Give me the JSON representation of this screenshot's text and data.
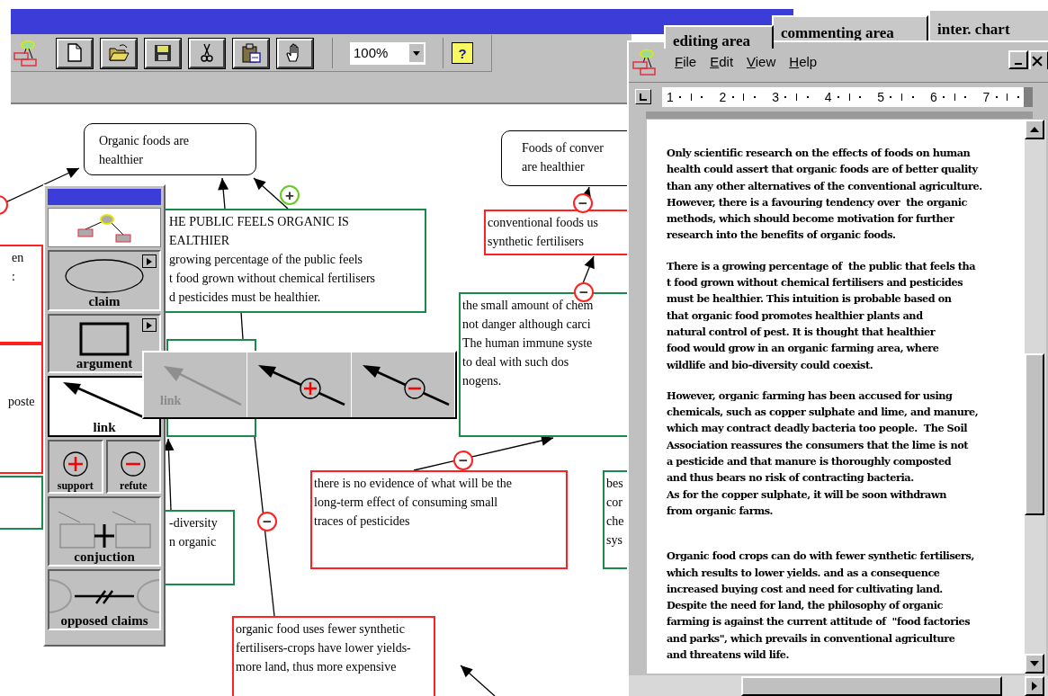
{
  "toolbar": {
    "buttons": [
      {
        "kind": "new"
      },
      {
        "kind": "open"
      },
      {
        "kind": "save"
      },
      {
        "kind": "cut"
      },
      {
        "kind": "paste"
      },
      {
        "kind": "hand"
      }
    ],
    "zoom": "100%",
    "help": "?"
  },
  "nodes": [
    {
      "kind": "claim",
      "color": "#000000",
      "text": "Organic foods are\nhealthier"
    },
    {
      "kind": "claim",
      "color": "#000000",
      "text": "Foods of conver\nare healthier"
    },
    {
      "kind": "argument",
      "color": "#1a8a4a",
      "text": "HE PUBLIC FEELS ORGANIC IS\nEALTHIER\ngrowing percentage of the public feels\nt food grown without chemical fertilisers\nd pesticides must be healthier."
    },
    {
      "kind": "argument",
      "color": "#ff2020",
      "text": "conventional foods us\nsynthetic fertilisers"
    },
    {
      "kind": "argument",
      "color": "#1a8a4a",
      "text": "the small amount of chem\nnot danger although carci\nThe human immune syste\nto deal with such dos\nnogens."
    },
    {
      "kind": "argument",
      "color": "#1a8a4a"
    },
    {
      "kind": "argument",
      "color": "#1a8a4a",
      "text": "-diversity\nn organic"
    },
    {
      "kind": "argument",
      "color": "#ff2020",
      "text": "there is no evidence of what will be the\nlong-term effect of consuming small\ntraces of pesticides"
    },
    {
      "kind": "argument",
      "color": "#1a8a4a",
      "text": "bes\ncor\nche\nsys"
    },
    {
      "kind": "argument",
      "color": "#ff2020",
      "text": "organic food uses fewer synthetic\nfertilisers-crops have lower yields-\nmore land, thus more expensive"
    },
    {
      "kind": "argument",
      "color": "#ff2020",
      "text": "en\n:"
    },
    {
      "kind": "argument",
      "color": "#ff2020",
      "text": "poste"
    },
    {
      "kind": "argument",
      "color": "#1a8a4a"
    }
  ],
  "badges": [
    {
      "color": "#ff2020"
    },
    {
      "sign": "+",
      "color": "#66cc22"
    },
    {
      "sign": "−",
      "color": "#ff2020"
    },
    {
      "sign": "−",
      "color": "#ff2020"
    },
    {
      "sign": "−",
      "color": "#ff2020"
    },
    {
      "sign": "−",
      "color": "#ff2020"
    }
  ],
  "palette": {
    "tools": [
      {
        "kind": "claim",
        "label": "claim",
        "selected": false
      },
      {
        "kind": "argument",
        "label": "argument",
        "selected": false
      },
      {
        "kind": "link",
        "label": "link",
        "selected": true
      },
      {
        "kind": "support",
        "label": "support",
        "selected": false
      },
      {
        "kind": "refute",
        "label": "refute",
        "selected": false
      },
      {
        "kind": "conjuction",
        "label": "conjuction",
        "selected": false
      },
      {
        "kind": "opposed",
        "label": "opposed claims",
        "selected": false
      }
    ]
  },
  "link_menu": [
    {
      "kind": "link",
      "label": "link",
      "disabled": true
    },
    {
      "kind": "support",
      "disabled": false
    },
    {
      "kind": "refute",
      "disabled": false
    }
  ],
  "tabs": [
    {
      "label": "editing area",
      "selected": true
    },
    {
      "label": "commenting area",
      "selected": false
    },
    {
      "label": "inter. chart",
      "selected": false
    }
  ],
  "editor": {
    "menu": [
      "File",
      "Edit",
      "View",
      "Help"
    ],
    "ruler": [
      "1",
      "2",
      "3",
      "4",
      "5",
      "6",
      "7"
    ],
    "paragraphs": [
      "Only scientific research on the effects of foods on human\nhealth could assert that organic foods are of better quality\nthan any other alternatives of the conventional agriculture.\nHowever, there is a favouring tendency over  the organic\nmethods, which should become motivation for further\nresearch into the benefits of organic foods.",
      "There is a growing percentage of  the public that feels tha\nt food grown without chemical fertilisers and pesticides\nmust be healthier. This intuition is probable based on\nthat organic food promotes healthier plants and\nnatural control of pest. It is thought that healthier\nfood would grow in an organic farming area, where\nwildlife and bio-diversity could coexist.",
      "However, organic farming has been accused for using\nchemicals, such as copper sulphate and lime, and manure,\nwhich may contract deadly bacteria too people.  The Soil\nAssociation reassures the consumers that the lime is not\na pesticide and that manure is thoroughly composted\nand thus bears no risk of contracting bacteria.\nAs for the copper sulphate, it will be soon withdrawn\nfrom organic farms.",
      "Organic food crops can do with fewer synthetic fertilisers,\nwhich results to lower yields. and as a consequence\nincreased buying cost and need for cultivating land.\nDespite the need for land, the philosophy of organic\nfarming is against the current attitude of  \"food factories\nand parks\", which prevails in conventional agriculture\nand threatens wild life."
    ]
  }
}
